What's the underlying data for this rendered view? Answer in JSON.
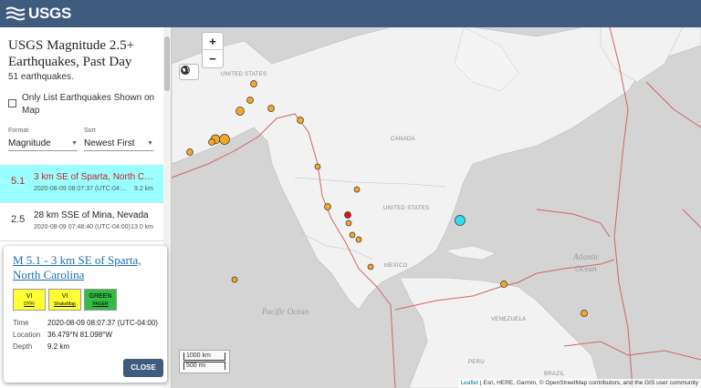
{
  "header": {
    "logo_text": "USGS"
  },
  "sidebar": {
    "title": "USGS Magnitude 2.5+ Earthquakes, Past Day",
    "count": "51 earthquakes.",
    "only_list_label": "Only List Earthquakes Shown on Map",
    "format_label": "Format",
    "format_value": "Magnitude",
    "sort_label": "Sort",
    "sort_value": "Newest First"
  },
  "earthquakes": [
    {
      "mag": "5.1",
      "place": "3 km SE of Sparta, North Carolina",
      "time": "2020-08-09 08:07:37 (UTC-04:...",
      "depth": "9.2 km",
      "selected": true
    },
    {
      "mag": "2.5",
      "place": "28 km SSE of Mina, Nevada",
      "time": "2020-08-09 07:48:40 (UTC-04:00)",
      "depth": "13.0 km",
      "selected": false
    }
  ],
  "popup": {
    "title": "M 5.1 - 3 km SE of Sparta, North Carolina",
    "badges": [
      {
        "value": "VI",
        "sub": "DYFI",
        "color": "#ffff33"
      },
      {
        "value": "VI",
        "sub": "ShakeMap",
        "color": "#ffff33"
      },
      {
        "value": "GREEN",
        "sub": "PAGER",
        "color": "#33bb44"
      }
    ],
    "time_label": "Time",
    "time_value": "2020-08-09 08:07:37 (UTC-04:00)",
    "location_label": "Location",
    "location_value": "36.479°N 81.098°W",
    "depth_label": "Depth",
    "depth_value": "9.2 km",
    "close_label": "CLOSE"
  },
  "map": {
    "zoom_in": "+",
    "zoom_out": "−",
    "layers_icon": "globe-icon",
    "scale_km": "1000 km",
    "scale_mi": "500 mi",
    "attribution_leaflet": "Leaflet",
    "attribution_rest": " | Esri, HERE, Garmin, © OpenStreetMap contributors, and the GIS user community",
    "labels": {
      "united_states_top": "UNITED STATES",
      "canada": "CANADA",
      "united_states": "UNITED STATES",
      "mexico": "MEXICO",
      "venezuela": "VENEZUELA",
      "peru": "PERU",
      "brazil": "BRAZIL",
      "pacific": "Pacific Ocean",
      "atlantic1": "Atlantic",
      "atlantic2": "Ocean"
    }
  },
  "colors": {
    "header": "#3f5b7d",
    "selected_row": "#99ffff",
    "plate_boundary": "#cc6666",
    "quake_orange": "#f5a623",
    "quake_red": "#dd1111",
    "quake_cyan": "#33ddee"
  }
}
